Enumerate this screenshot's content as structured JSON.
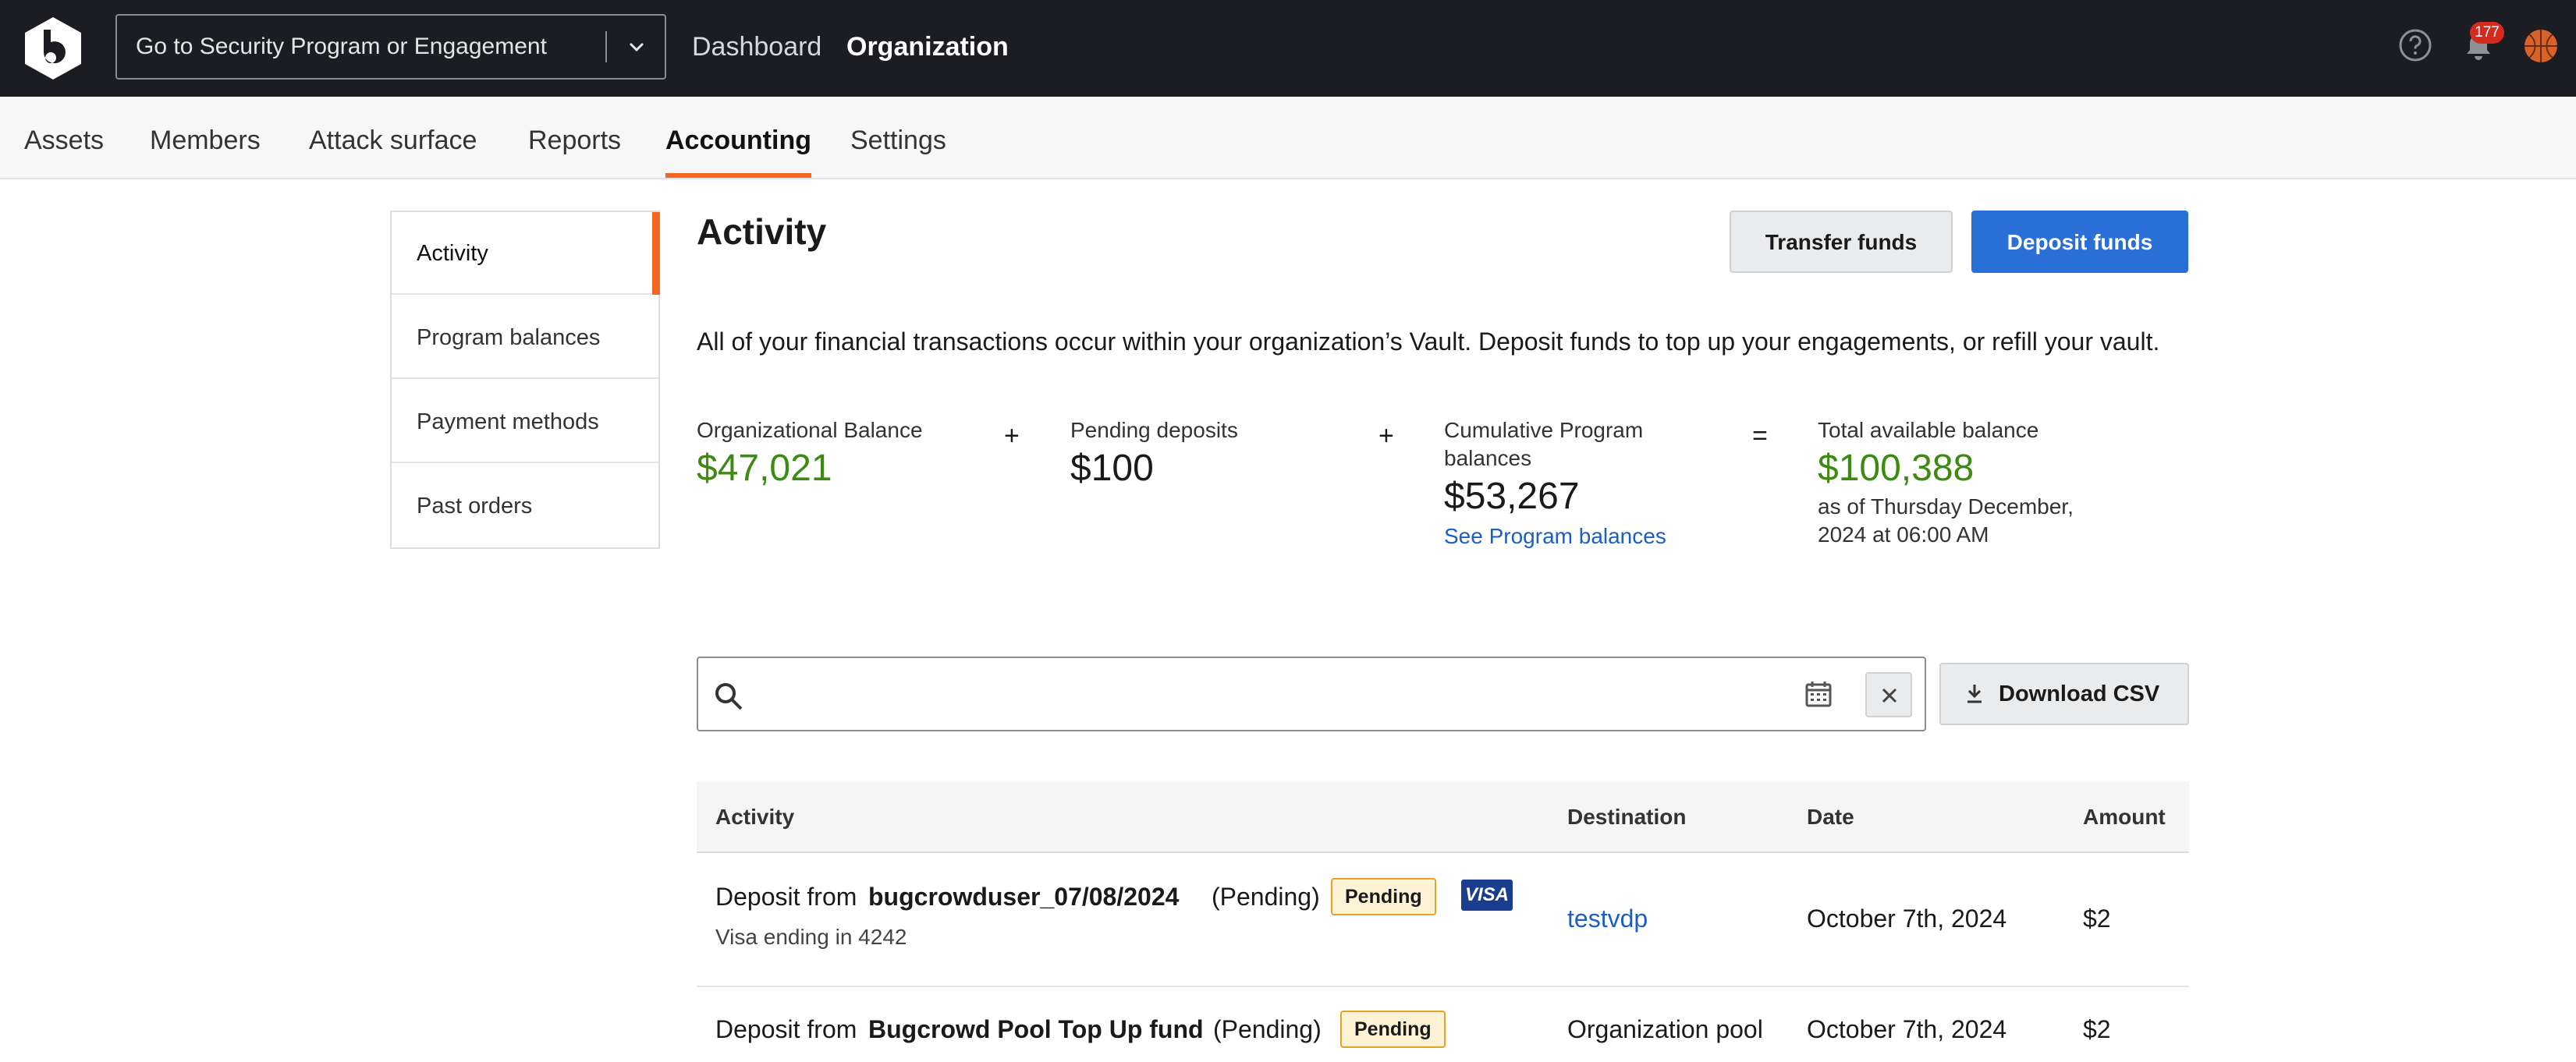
{
  "topbar": {
    "program_select_placeholder": "Go to Security Program or Engagement",
    "nav": [
      "Dashboard",
      "Organization"
    ],
    "active_nav": "Organization",
    "notification_count": "177"
  },
  "subnav": {
    "tabs": [
      "Assets",
      "Members",
      "Attack surface",
      "Reports",
      "Accounting",
      "Settings"
    ],
    "active": "Accounting"
  },
  "sidebar": {
    "items": [
      "Activity",
      "Program balances",
      "Payment methods",
      "Past orders"
    ],
    "active": "Activity"
  },
  "main": {
    "title": "Activity",
    "transfer_label": "Transfer funds",
    "deposit_label": "Deposit funds",
    "description": "All of your financial transactions occur within your organization’s Vault. Deposit funds to top up your engagements, or refill your vault."
  },
  "balances": {
    "org_label": "Organizational Balance",
    "org_value": "$47,021",
    "plus1": "+",
    "pending_label": "Pending deposits",
    "pending_value": "$100",
    "plus2": "+",
    "cumulative_label": "Cumulative Program balances",
    "cumulative_value": "$53,267",
    "cumulative_link": "See Program balances",
    "equals": "=",
    "total_label": "Total available balance",
    "total_value": "$100,388",
    "total_note": "as of Thursday December, 2024 at 06:00 AM"
  },
  "search": {
    "placeholder": "",
    "download_label": "Download CSV"
  },
  "table": {
    "columns": [
      "Activity",
      "Destination",
      "Date",
      "Amount"
    ],
    "rows": [
      {
        "prefix": "Deposit from",
        "name": "bugcrowduser_07/08/2024",
        "status": "(Pending)",
        "badge": "Pending",
        "card_brand": "VISA",
        "subline": "Visa ending in 4242",
        "destination": "testvdp",
        "date": "October 7th, 2024",
        "amount": "$2"
      },
      {
        "prefix": "Deposit from",
        "name": "Bugcrowd Pool Top Up fund",
        "status": "(Pending)",
        "badge": "Pending",
        "destination": "Organization pool",
        "date": "October 7th, 2024",
        "amount": "$2"
      }
    ]
  },
  "colors": {
    "accent_orange": "#f26722",
    "primary_blue": "#2a6fd6",
    "balance_green": "#3c8a12",
    "link_blue": "#1a5fc4",
    "topbar_bg": "#1b1d22"
  },
  "icons": [
    "bugcrowd-logo-icon",
    "chevron-down-icon",
    "help-icon",
    "bell-icon",
    "avatar-icon",
    "search-icon",
    "calendar-icon",
    "close-icon",
    "download-icon",
    "visa-card-icon"
  ]
}
